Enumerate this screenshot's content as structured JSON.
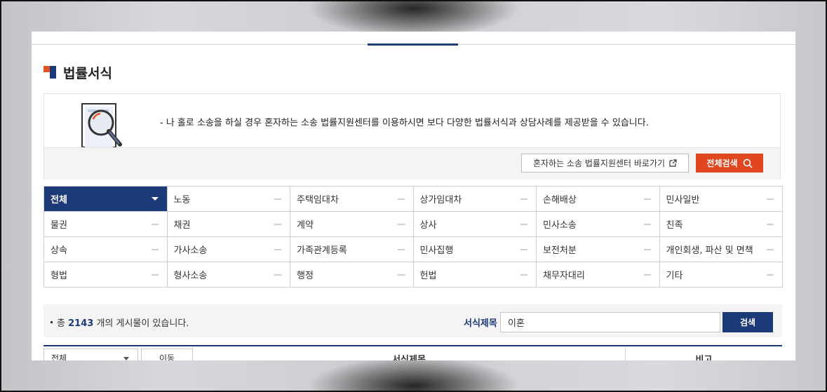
{
  "page_title": "법률서식",
  "notice": {
    "text": "- 나 홀로 소송을 하실 경우 혼자하는 소송 법률지원센터를 이용하시면 보다 다양한 법률서식과 상담사례를 제공받을 수 있습니다.",
    "link_button": "혼자하는 소송 법률지원센터 바로가기",
    "search_all_button": "전체검색"
  },
  "categories": [
    "전체",
    "노동",
    "주택임대차",
    "상가임대차",
    "손해배상",
    "민사일반",
    "물권",
    "채권",
    "계약",
    "상사",
    "민사소송",
    "친족",
    "상속",
    "가사소송",
    "가족관계등록",
    "민사집행",
    "보전처분",
    "개인회생, 파산 및 면책",
    "형법",
    "형사소송",
    "행정",
    "헌법",
    "채무자대리",
    "기타"
  ],
  "active_category": "전체",
  "search": {
    "count_prefix": "총",
    "count": "2143",
    "count_suffix": "개의 게시물이 있습니다.",
    "label": "서식제목",
    "value": "이혼",
    "button": "검색"
  },
  "table": {
    "filter_value": "전체",
    "move_button": "이동",
    "col_title": "서식제목",
    "col_note": "비고"
  },
  "colors": {
    "accent_blue": "#1d3a78",
    "accent_orange": "#e0461f"
  }
}
